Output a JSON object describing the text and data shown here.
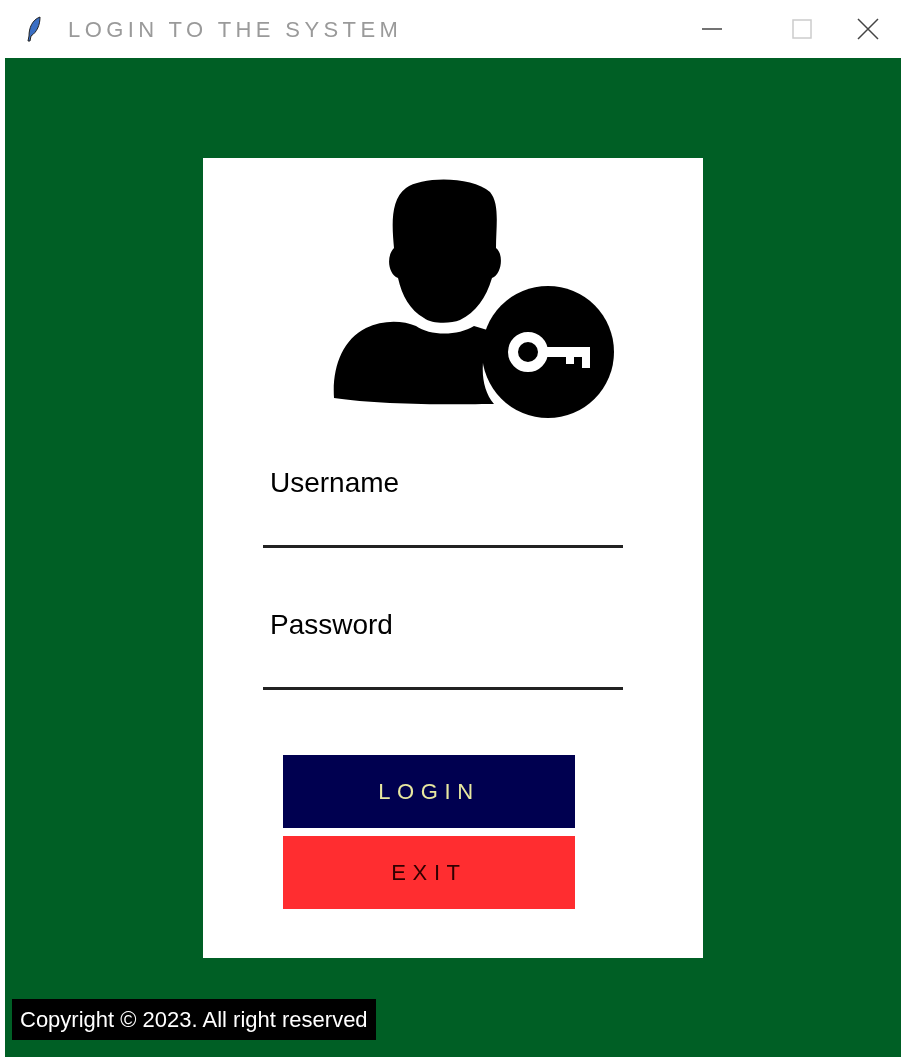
{
  "window": {
    "title": "LOGIN TO THE SYSTEM"
  },
  "form": {
    "fields": [
      {
        "label": "Username"
      },
      {
        "label": "Password"
      }
    ],
    "buttons": [
      {
        "label": "LOGIN",
        "kind": "primary"
      },
      {
        "label": "EXIT",
        "kind": "danger"
      }
    ]
  },
  "footer": {
    "copyright": "Copyright © 2023. All right reserved"
  }
}
